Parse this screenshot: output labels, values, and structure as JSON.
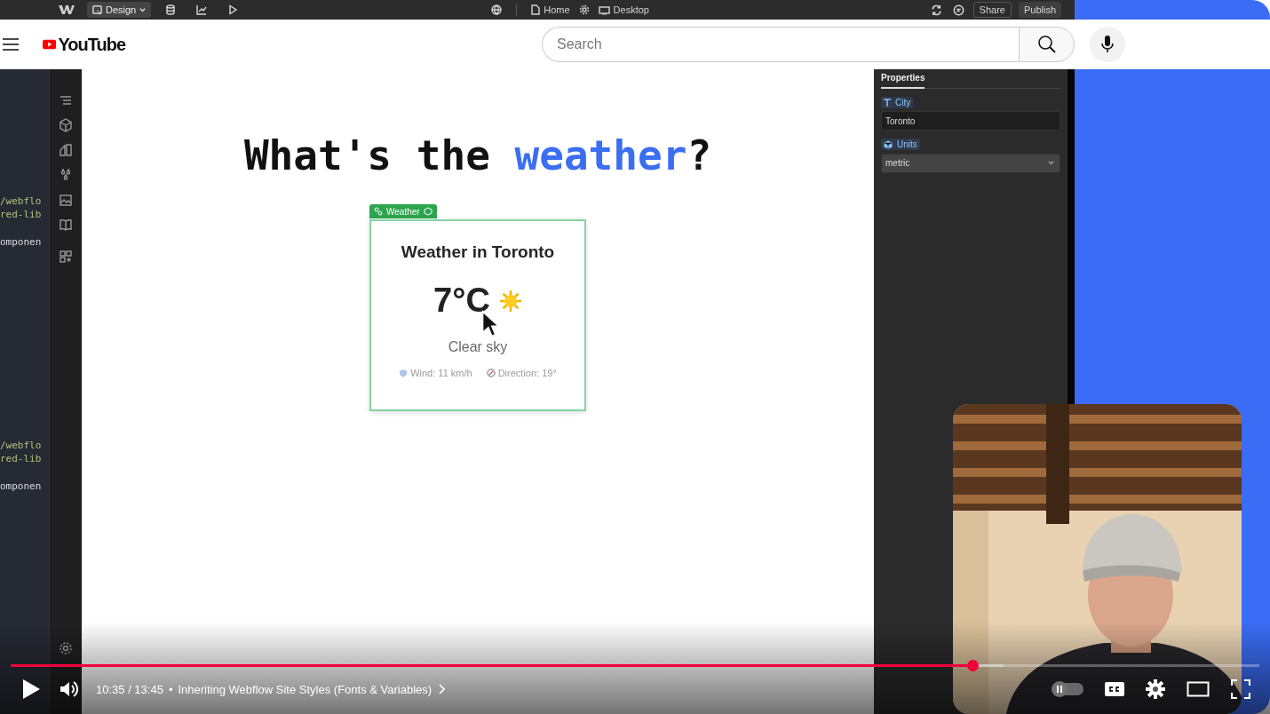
{
  "video_frame": {
    "topbar": {
      "mode_button": "Design",
      "page": "Home",
      "breakpoint": "Desktop",
      "share_button": "Share",
      "publish_button": "Publish"
    },
    "code_blocks": [
      {
        "lines": [
          {
            "kind": "path",
            "text": "/webflo"
          },
          {
            "kind": "path",
            "text": "red-lib"
          },
          {
            "kind": "plain",
            "text": "omponen"
          }
        ]
      },
      {
        "lines": [
          {
            "kind": "path",
            "text": "/webflo"
          },
          {
            "kind": "path",
            "text": "red-lib"
          },
          {
            "kind": "plain",
            "text": "omponen"
          }
        ]
      }
    ],
    "canvas": {
      "headline": [
        {
          "kind": "plain",
          "text": "What's the "
        },
        {
          "kind": "accent",
          "text": "weather"
        },
        {
          "kind": "plain",
          "text": "?"
        }
      ],
      "component_tag": "Weather",
      "card": {
        "title": "Weather in Toronto",
        "temperature": "7°C",
        "condition": "Clear sky",
        "wind": "Wind: 11 km/h",
        "direction": "Direction: 19°"
      }
    },
    "properties": {
      "tab": "Properties",
      "fields": [
        {
          "kind": "text",
          "label": "City",
          "value": "Toronto"
        },
        {
          "kind": "select",
          "label": "Units",
          "value": "metric"
        }
      ]
    }
  },
  "header": {
    "logo": "YouTube",
    "search": {
      "placeholder": "Search"
    }
  },
  "player": {
    "playing": false,
    "progress": {
      "level": 0.77
    },
    "buffer": {
      "level": 0.795
    },
    "time": "10:35 / 13:45",
    "separator": "•",
    "chapter": "Inheriting Webflow Site Styles (Fonts & Variables)",
    "autoplay": false
  }
}
